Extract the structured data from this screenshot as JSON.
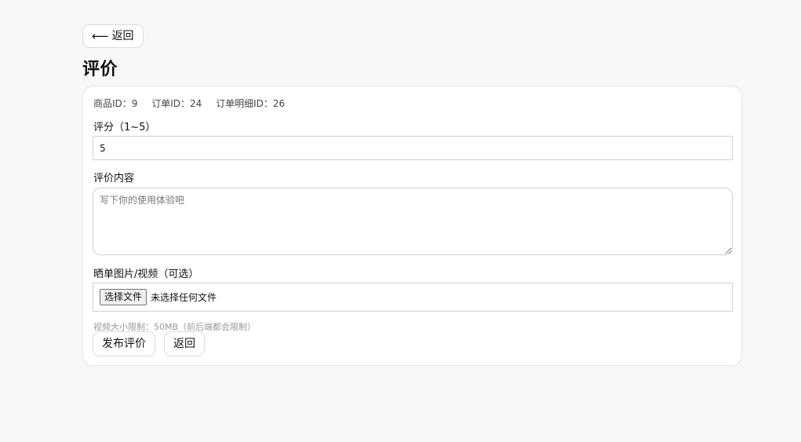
{
  "header": {
    "back_arrow": "⟵",
    "back_label": "返回",
    "title": "评价"
  },
  "meta": {
    "product_id": "商品ID：9",
    "order_id": "订单ID：24",
    "order_item_id": "订单明细ID：26"
  },
  "rating": {
    "label": "评分（1~5）",
    "value": "5"
  },
  "content": {
    "label": "评价内容",
    "placeholder": "写下你的使用体验吧",
    "value": ""
  },
  "media": {
    "label": "晒单图片/视频（可选）",
    "choose_button": "选择文件",
    "status": "未选择任何文件",
    "hint": "视频大小限制：50MB（前后端都会限制）"
  },
  "actions": {
    "submit_label": "发布评价",
    "return_label": "返回"
  }
}
